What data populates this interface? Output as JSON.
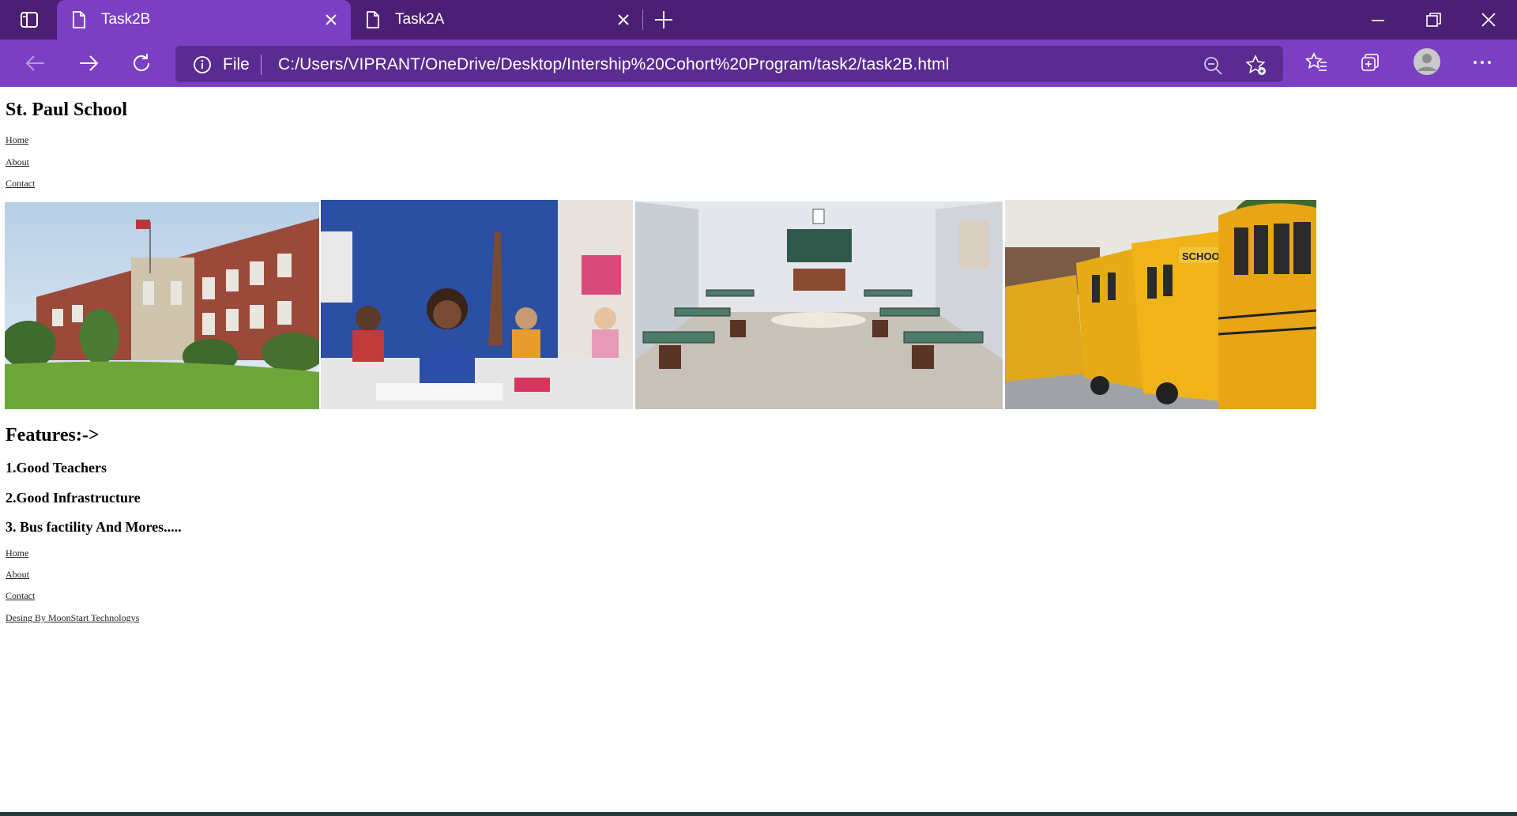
{
  "browser": {
    "tabs": [
      {
        "title": "Task2B",
        "active": true
      },
      {
        "title": "Task2A",
        "active": false
      }
    ],
    "address": {
      "scheme_label": "File",
      "url": "C:/Users/VIPRANT/OneDrive/Desktop/Intership%20Cohort%20Program/task2/task2B.html"
    },
    "colors": {
      "tabbar": "#4b1f73",
      "toolbar": "#7b3fc4",
      "omnibox": "#5a2c91"
    }
  },
  "page": {
    "title": "St. Paul School",
    "nav_top": [
      "Home",
      "About",
      "Contact"
    ],
    "photos": [
      {
        "subject": "school building"
      },
      {
        "subject": "students in classroom"
      },
      {
        "subject": "empty classroom"
      },
      {
        "subject": "school buses"
      }
    ],
    "features_heading": "Features:->",
    "features": [
      "1.Good Teachers",
      "2.Good Infrastructure",
      "3. Bus factility And Mores....."
    ],
    "nav_bottom": [
      "Home",
      "About",
      "Contact"
    ],
    "credit": "Desing By MoonStart Technologys"
  }
}
